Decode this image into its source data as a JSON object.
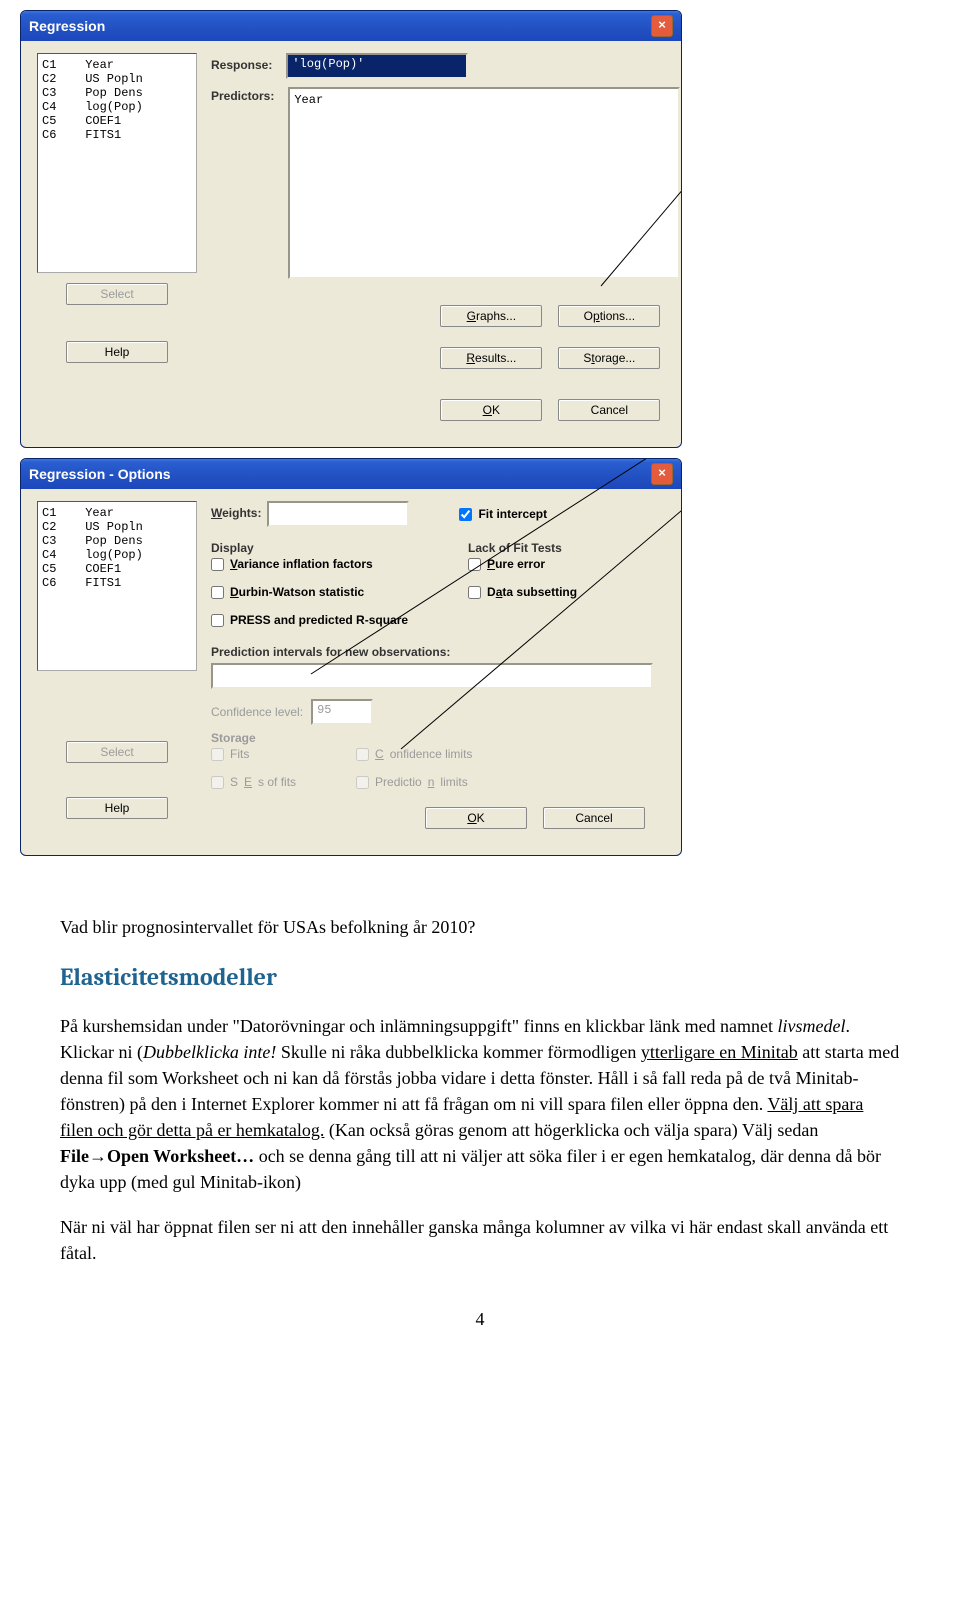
{
  "dlg1": {
    "title": "Regression",
    "cols": "C1    Year\nC2    US Popln\nC3    Pop Dens\nC4    log(Pop)\nC5    COEF1\nC6    FITS1",
    "responseLbl": "Response:",
    "responseVal": "'log(Pop)'",
    "predictorsLbl": "Predictors:",
    "predictorsVal": "Year",
    "btns": {
      "graphs": "Graphs...",
      "options": "Options...",
      "results": "Results...",
      "storage": "Storage...",
      "select": "Select",
      "help": "Help",
      "ok": "OK",
      "cancel": "Cancel"
    }
  },
  "dlg2": {
    "title": "Regression - Options",
    "cols": "C1    Year\nC2    US Popln\nC3    Pop Dens\nC4    log(Pop)\nC5    COEF1\nC6    FITS1",
    "weightsLbl": "Weights:",
    "fitIntercept": "Fit intercept",
    "displayHdr": "Display",
    "vif": "Variance inflation factors",
    "dw": "Durbin-Watson statistic",
    "press": "PRESS and predicted R-square",
    "lofHdr": "Lack of Fit Tests",
    "pure": "Pure error",
    "datasub": "Data subsetting",
    "predHdr": "Prediction intervals for new observations:",
    "confLbl": "Confidence level:",
    "confVal": "95",
    "storageHdr": "Storage",
    "fits": "Fits",
    "confLimits": "Confidence limits",
    "seFits": "SEs of fits",
    "predLimits": "Prediction limits",
    "btns": {
      "select": "Select",
      "help": "Help",
      "ok": "OK",
      "cancel": "Cancel"
    }
  },
  "doc": {
    "q": "Vad blir prognosintervallet för USAs befolkning år 2010?",
    "h": "Elasticitetsmodeller",
    "p1a": "På kurshemsidan under \"Datorövningar och inlämningsuppgift\" finns en klickbar länk med namnet ",
    "p1em": "livsmedel",
    "p1b": ". Klickar ni (",
    "p1em2": "Dubbelklicka inte!",
    "p1c": " Skulle ni råka dubbelklicka kommer förmodligen ",
    "p1u1": "ytterligare en Minitab",
    "p1d": " att starta med denna fil som Worksheet och ni kan då förstås jobba vidare i detta fönster. Håll i så fall reda på de två Minitab-fönstren) på den i Internet Explorer kommer ni att få frågan om ni vill spara filen eller öppna den. ",
    "p1u2": "Välj att spara filen och gör detta på er hemkatalog.",
    "p1e": " (Kan också göras genom att högerklicka och välja spara) Välj sedan ",
    "p1s1": "File",
    "p1arrow": "→",
    "p1s2": "Open Worksheet…",
    "p1f": " och se denna gång till att ni väljer att söka filer i er egen hemkatalog, där denna då bör dyka upp (med gul Minitab-ikon)",
    "p2": "När ni väl har öppnat filen ser ni att den innehåller ganska många kolumner av vilka vi här endast skall använda ett fåtal.",
    "pagenum": "4"
  }
}
